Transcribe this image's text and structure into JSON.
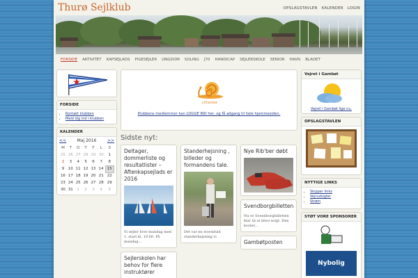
{
  "site": {
    "title": "Thurø Sejlklub"
  },
  "top_links": [
    "OPSLAGSTAVLEN",
    "KALENDER",
    "LOGIN"
  ],
  "nav": [
    "FORSIDE",
    "AKTIVITET",
    "KAPSEJLADS",
    "PIGESEJLER",
    "UNGDOM",
    "SOLING",
    "J70",
    "HANDICAP",
    "SEJLERSKOLE",
    "SENIOR",
    "HAVN",
    "BLADET"
  ],
  "left": {
    "forside_title": "FORSIDE",
    "forside_links": [
      "Kontakt klubben",
      "Meld dig ind i klubben"
    ],
    "calendar_title": "KALENDER",
    "calendar": {
      "prev": "<<",
      "month": "Maj 2016",
      "next": ">>",
      "weekdays": [
        "M",
        "T",
        "O",
        "T",
        "F",
        "L",
        "S"
      ],
      "weeks": [
        [
          "25",
          "26",
          "27",
          "28",
          "29",
          "30",
          "1"
        ],
        [
          "2",
          "3",
          "4",
          "5",
          "6",
          "7",
          "8"
        ],
        [
          "9",
          "10",
          "11",
          "12",
          "13",
          "14",
          "15"
        ],
        [
          "16",
          "17",
          "18",
          "19",
          "20",
          "21",
          "22"
        ],
        [
          "23",
          "24",
          "25",
          "26",
          "27",
          "28",
          "29"
        ],
        [
          "30",
          "31",
          "1",
          "2",
          "3",
          "4",
          "5"
        ]
      ]
    }
  },
  "intro": {
    "logo_text": "cittaslow",
    "text": "Klubbens medlemmer kan LOGGE IND her, og få adgang til hele hjemmesiden."
  },
  "latest_title": "Sidste nyt:",
  "posts": {
    "p1": {
      "title": "Deltager, dommerliste og resultatlister – Aftenkapsejlads er 2016",
      "excerpt": "Vi sejler hver mandag med 1. start kl. 19.00. På mandag..."
    },
    "p2": {
      "title": "Sejlerskolen har behov for flere instruktører"
    },
    "p3": {
      "title": "Standerhejsning , billeder og formandens tale.",
      "excerpt": "Det var en stormfuld standerhejsning vi"
    },
    "p4": {
      "title": "Nye Rib'ber døbt"
    },
    "p5": {
      "title": "Svendborgbilletten",
      "excerpt": "Nu er Svendborgbilletten klar til at blive solgt. Den koster..."
    },
    "p6": {
      "title": "Gambøtposten"
    }
  },
  "right": {
    "weather_title": "Vejret i Gambøt",
    "weather_link": "Vejret i Gambøt lige nu.",
    "board_title": "OPSLAGSTAVLEN",
    "links_title": "NYTTIGE LINKS",
    "links": [
      "Skipper links",
      "Vejrudsigter",
      "Strøm"
    ],
    "sponsor_title": "STØT VORE SPONSORER",
    "sponsor_logo": "Nybolig"
  },
  "colors": {
    "title": "#c8632d",
    "link": "#223a8a",
    "active_nav": "#c0392b"
  }
}
